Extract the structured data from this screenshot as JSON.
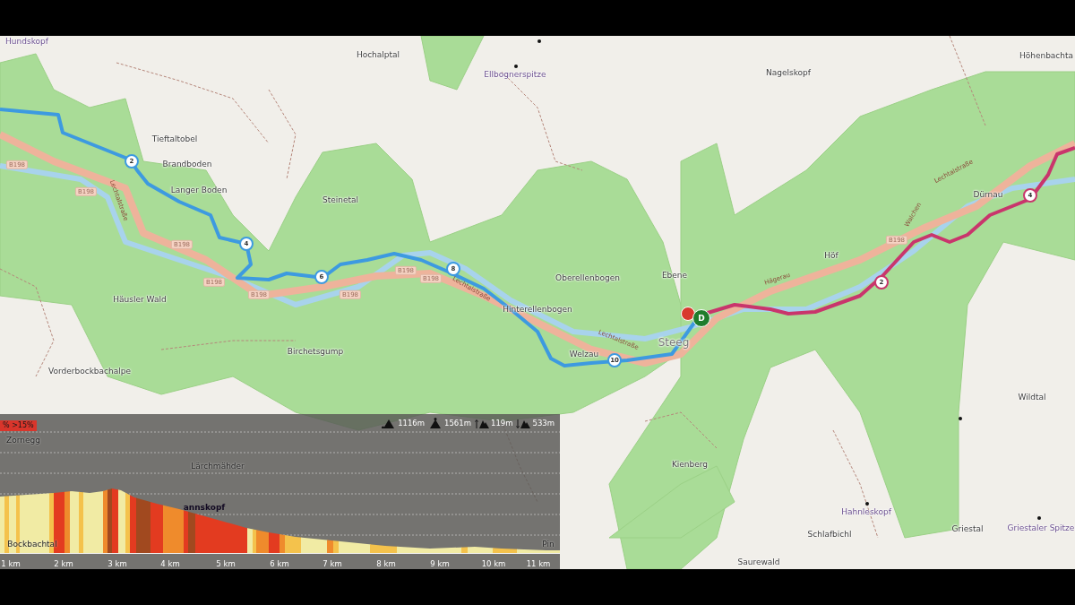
{
  "map": {
    "places": [
      {
        "name": "Hundskopf",
        "kind": "peak"
      },
      {
        "name": "Hochalptal",
        "kind": "place"
      },
      {
        "name": "Ellbognerspitze",
        "kind": "peak"
      },
      {
        "name": "Nagelskopf",
        "kind": "place"
      },
      {
        "name": "Höhenbachta",
        "kind": "place"
      },
      {
        "name": "Tieftaltobel",
        "kind": "place"
      },
      {
        "name": "Brandboden",
        "kind": "place"
      },
      {
        "name": "Langer Boden",
        "kind": "place"
      },
      {
        "name": "Steinetal",
        "kind": "place"
      },
      {
        "name": "Häusler Wald",
        "kind": "place"
      },
      {
        "name": "Birchetsgump",
        "kind": "place"
      },
      {
        "name": "Vorderbockbachalpe",
        "kind": "place"
      },
      {
        "name": "Oberellenbogen",
        "kind": "place"
      },
      {
        "name": "Ebene",
        "kind": "place"
      },
      {
        "name": "Hinterellenbogen",
        "kind": "place"
      },
      {
        "name": "Welzau",
        "kind": "place"
      },
      {
        "name": "Steeg",
        "kind": "village"
      },
      {
        "name": "Höf",
        "kind": "place"
      },
      {
        "name": "Dürnau",
        "kind": "place"
      },
      {
        "name": "Wildtal",
        "kind": "place"
      },
      {
        "name": "Kienberg",
        "kind": "place"
      },
      {
        "name": "Hahnleskopf",
        "kind": "peak"
      },
      {
        "name": "Schlafbichl",
        "kind": "place"
      },
      {
        "name": "Griestal",
        "kind": "place"
      },
      {
        "name": "Griestaler Spitze",
        "kind": "peak"
      },
      {
        "name": "Saurewald",
        "kind": "place"
      }
    ],
    "road_labels": [
      {
        "text": "B198",
        "kind": "shield"
      },
      {
        "text": "B198",
        "kind": "shield"
      },
      {
        "text": "B198",
        "kind": "shield"
      },
      {
        "text": "B198",
        "kind": "shield"
      },
      {
        "text": "B198",
        "kind": "shield"
      },
      {
        "text": "B198",
        "kind": "shield"
      },
      {
        "text": "B198",
        "kind": "shield"
      },
      {
        "text": "B198",
        "kind": "shield"
      },
      {
        "text": "B198",
        "kind": "shield"
      },
      {
        "text": "Lechtalstraße",
        "kind": "street"
      },
      {
        "text": "Lechtalstraße",
        "kind": "street"
      },
      {
        "text": "Lechtalstraße",
        "kind": "street"
      },
      {
        "text": "Hägerau",
        "kind": "street"
      },
      {
        "text": "Walchen",
        "kind": "street"
      },
      {
        "text": "Lechtalstraße",
        "kind": "street"
      }
    ],
    "routes": [
      {
        "color": "#3d9ae0"
      },
      {
        "color": "#c9356c"
      }
    ],
    "route_markers": [
      {
        "label": "2",
        "color": "#3d9ae0"
      },
      {
        "label": "4",
        "color": "#3d9ae0"
      },
      {
        "label": "6",
        "color": "#3d9ae0"
      },
      {
        "label": "8",
        "color": "#3d9ae0"
      },
      {
        "label": "10",
        "color": "#3d9ae0"
      },
      {
        "label": "2",
        "color": "#c9356c"
      },
      {
        "label": "4",
        "color": "#c9356c"
      }
    ],
    "pins": [
      {
        "color": "#d8392d"
      },
      {
        "label": "D",
        "color": "#1f7d2c"
      }
    ]
  },
  "elevation": {
    "legend": "% >15%",
    "stats": [
      {
        "kind": "lowest",
        "value": "1116m"
      },
      {
        "kind": "highest",
        "value": "1561m"
      },
      {
        "kind": "ascent",
        "value": "119m"
      },
      {
        "kind": "descent",
        "value": "533m"
      }
    ],
    "places": [
      {
        "name": "Zornegg",
        "kind": "place"
      },
      {
        "name": "Lärchmähder",
        "kind": "place"
      },
      {
        "name": "annskopf",
        "kind": "peak"
      },
      {
        "name": "Bockbachtal",
        "kind": "place"
      },
      {
        "name": "Pin",
        "kind": "place"
      }
    ],
    "km_ticks": [
      "1 km",
      "2 km",
      "3 km",
      "4 km",
      "5 km",
      "6 km",
      "7 km",
      "8 km",
      "9 km",
      "10 km",
      "11 km"
    ]
  }
}
